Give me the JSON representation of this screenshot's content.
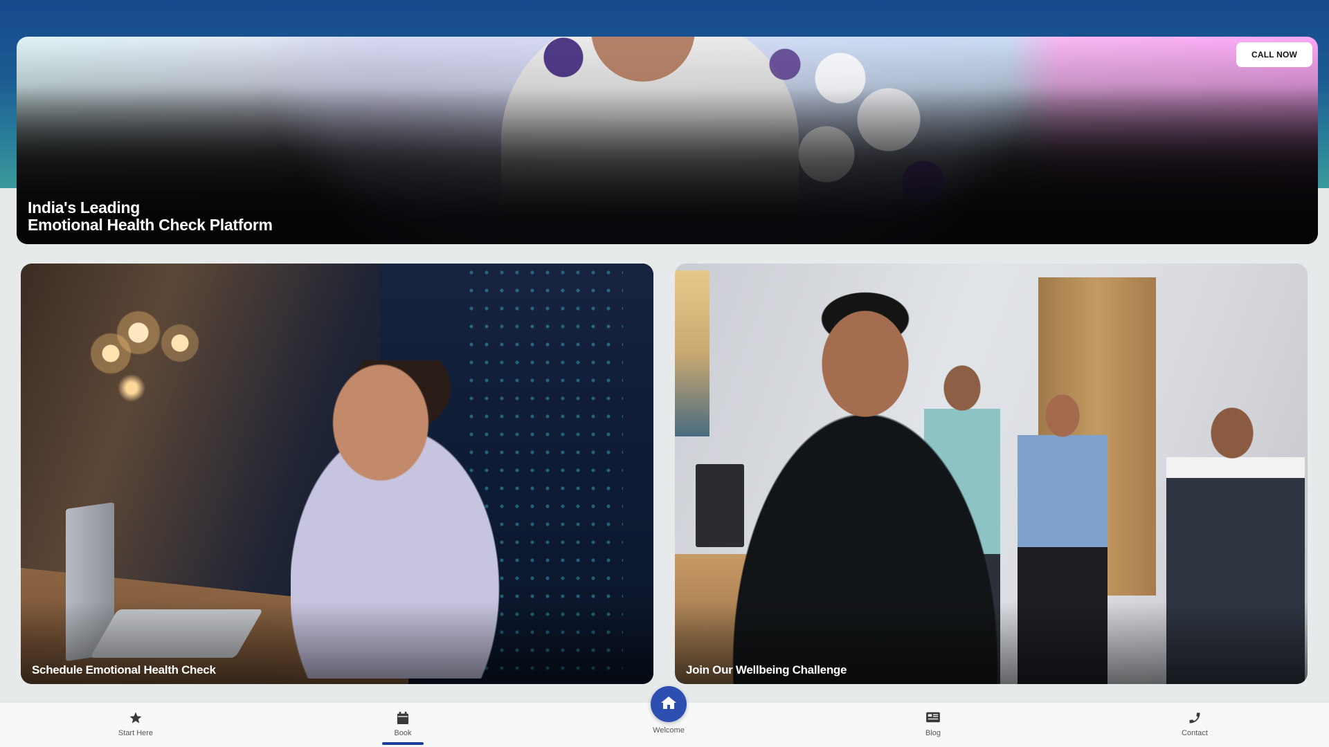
{
  "hero": {
    "title_line1": "India's Leading",
    "title_line2": "Emotional Health Check Platform",
    "call_button": "CALL NOW"
  },
  "cards": [
    {
      "label": "Schedule Emotional Health Check"
    },
    {
      "label": "Join Our Wellbeing Challenge"
    }
  ],
  "bottom_nav": {
    "items": [
      {
        "label": "Start Here",
        "icon": "star-icon"
      },
      {
        "label": "Book",
        "icon": "calendar-icon",
        "active": true
      },
      {
        "label": "Welcome",
        "icon": "home-icon"
      },
      {
        "label": "Blog",
        "icon": "newspaper-icon"
      },
      {
        "label": "Contact",
        "icon": "phone-icon"
      }
    ]
  },
  "colors": {
    "primary_blue": "#17498b",
    "nav_active": "#1d3e9c",
    "home_button": "#2e4fb2",
    "background": "#e6eaea"
  }
}
